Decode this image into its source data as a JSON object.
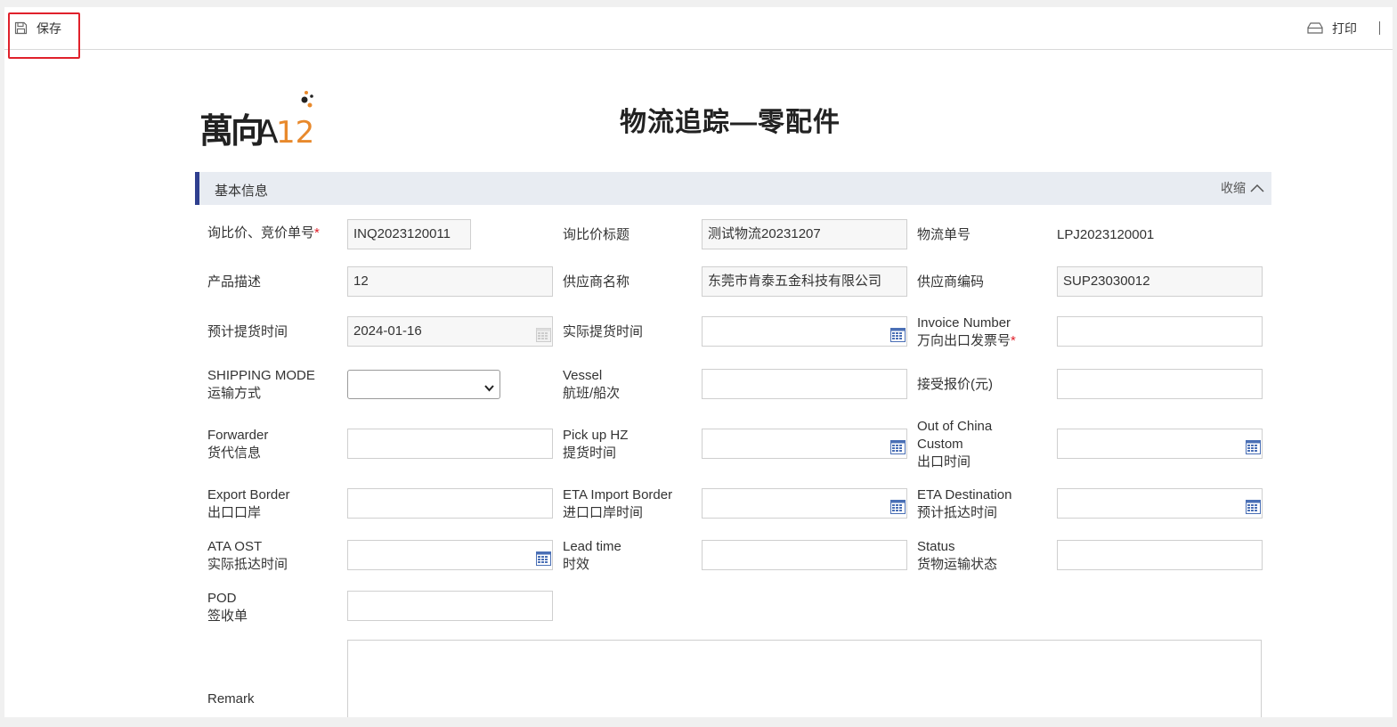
{
  "toolbar": {
    "save_label": "保存",
    "print_label": "打印"
  },
  "header": {
    "logo_text": "万向A123",
    "title": "物流追踪—零配件"
  },
  "section": {
    "title": "基本信息",
    "collapse_label": "收缩"
  },
  "form": {
    "inquiry_no": {
      "label": "询比价、竞价单号",
      "required": "*",
      "value": "INQ2023120011"
    },
    "inquiry_title": {
      "label": "询比价标题",
      "value": "测试物流20231207"
    },
    "logistics_no": {
      "label": "物流单号",
      "value": "LPJ2023120001"
    },
    "product_desc": {
      "label": "产品描述",
      "value": "12"
    },
    "supplier_name": {
      "label": "供应商名称",
      "value": "东莞市肯泰五金科技有限公司"
    },
    "supplier_code": {
      "label": "供应商编码",
      "value": "SUP23030012"
    },
    "planned_pickup": {
      "label": "预计提货时间",
      "value": "2024-01-16"
    },
    "actual_pickup": {
      "label": "实际提货时间",
      "value": ""
    },
    "invoice_number": {
      "label_en": "Invoice Number",
      "label_cn": "万向出口发票号",
      "required": "*",
      "value": ""
    },
    "shipping_mode": {
      "label_en": "SHIPPING MODE",
      "label_cn": "运输方式",
      "value": ""
    },
    "vessel": {
      "label_en": "Vessel",
      "label_cn": "航班/船次",
      "value": ""
    },
    "accepted_quote": {
      "label": "接受报价(元)",
      "value": ""
    },
    "forwarder": {
      "label_en": "Forwarder",
      "label_cn": "货代信息",
      "value": ""
    },
    "pickup_hz": {
      "label_en": "Pick up HZ",
      "label_cn": "提货时间",
      "value": ""
    },
    "out_of_china": {
      "label_en1": "Out of China",
      "label_en2": "Custom",
      "label_cn": "出口时间",
      "value": ""
    },
    "export_border": {
      "label_en": "Export Border",
      "label_cn": "出口口岸",
      "value": ""
    },
    "eta_import_border": {
      "label_en": "ETA Import Border",
      "label_cn": "进口口岸时间",
      "value": ""
    },
    "eta_destination": {
      "label_en": "ETA Destination",
      "label_cn": "预计抵达时间",
      "value": ""
    },
    "ata_ost": {
      "label_en": "ATA OST",
      "label_cn": "实际抵达时间",
      "value": ""
    },
    "lead_time": {
      "label_en": "Lead time",
      "label_cn": "时效",
      "value": ""
    },
    "status": {
      "label_en": "Status",
      "label_cn": "货物运输状态",
      "value": ""
    },
    "pod": {
      "label_en": "POD",
      "label_cn": "签收单",
      "value": ""
    },
    "remark": {
      "label": "Remark",
      "value": ""
    }
  },
  "colors": {
    "accent": "#2f3f8f",
    "required": "#e0212b",
    "highlight": "#e0212b",
    "section_bg": "#e8ecf2"
  }
}
